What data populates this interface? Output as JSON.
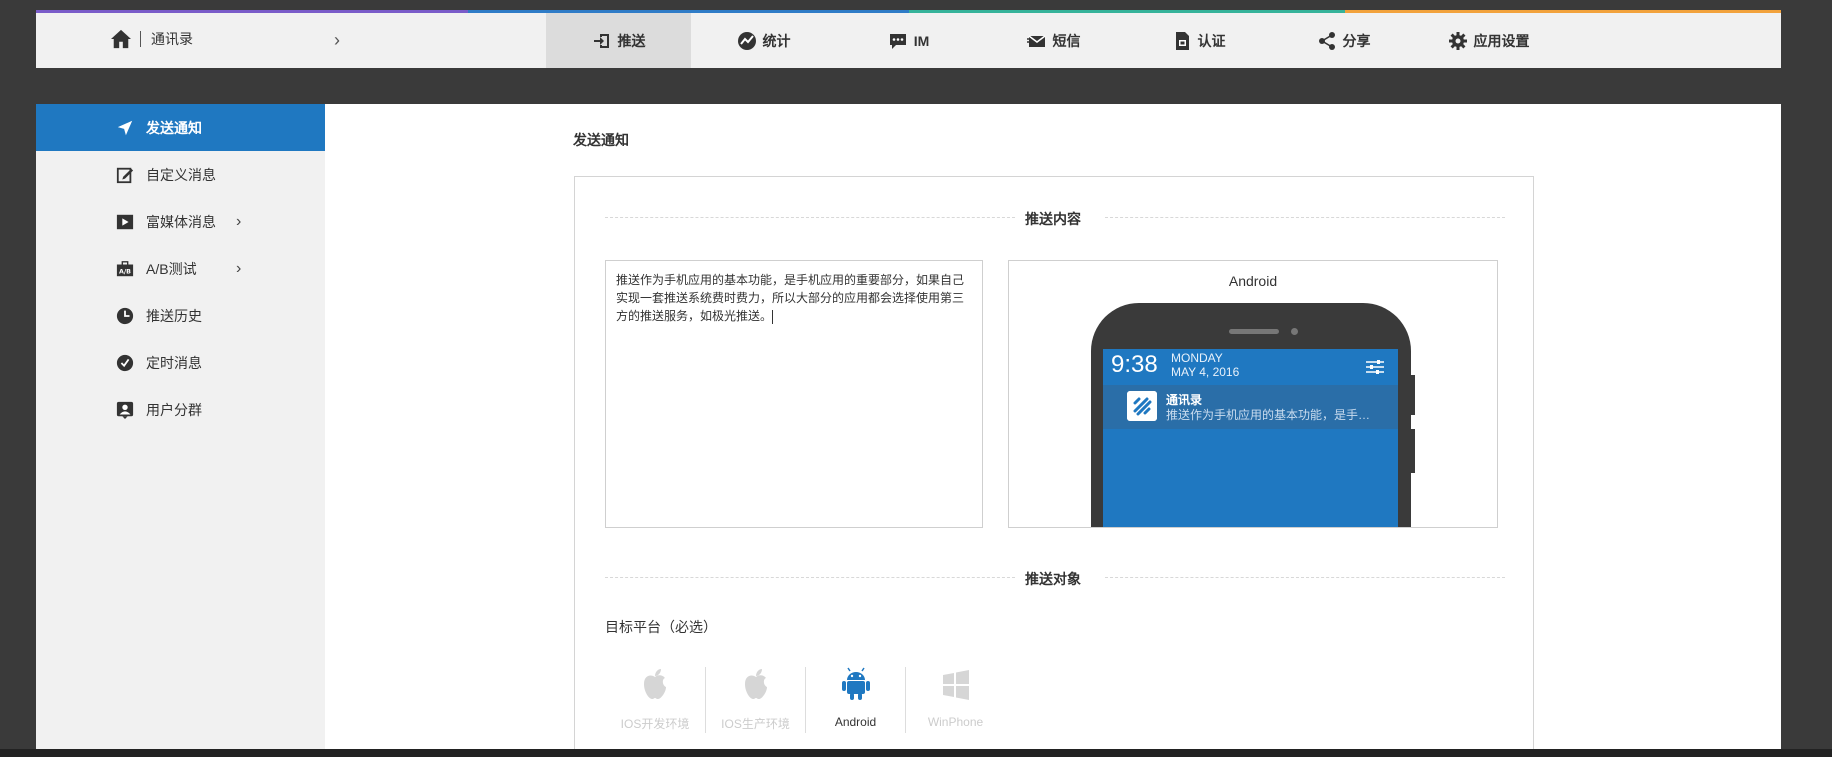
{
  "colors": {
    "accent": "#1f78c1",
    "strip": [
      "#7a5cc9",
      "#2f7cc7",
      "#36b39a",
      "#f2a23c"
    ]
  },
  "brand": {
    "icon": "home-icon",
    "label": "通讯录"
  },
  "nav": {
    "items": [
      {
        "label": "推送",
        "icon": "push-icon",
        "active": true
      },
      {
        "label": "统计",
        "icon": "stats-icon"
      },
      {
        "label": "IM",
        "icon": "chat-icon"
      },
      {
        "label": "短信",
        "icon": "sms-icon"
      },
      {
        "label": "认证",
        "icon": "auth-icon"
      },
      {
        "label": "分享",
        "icon": "share-icon"
      },
      {
        "label": "应用设置",
        "icon": "gear-icon"
      }
    ]
  },
  "sidebar": {
    "items": [
      {
        "label": "发送通知",
        "icon": "send-icon",
        "active": true
      },
      {
        "label": "自定义消息",
        "icon": "edit-icon"
      },
      {
        "label": "富媒体消息",
        "icon": "play-icon",
        "has_children": true
      },
      {
        "label": "A/B测试",
        "icon": "ab-test-icon",
        "has_children": true
      },
      {
        "label": "推送历史",
        "icon": "clock-icon"
      },
      {
        "label": "定时消息",
        "icon": "timer-icon"
      },
      {
        "label": "用户分群",
        "icon": "user-group-icon"
      }
    ]
  },
  "main": {
    "title": "发送通知",
    "section_content": "推送内容",
    "section_target": "推送对象",
    "message_text": "推送作为手机应用的基本功能，是手机应用的重要部分，如果自己实现一套推送系统费时费力，所以大部分的应用都会选择使用第三方的推送服务，如极光推送。",
    "preview": {
      "platform": "Android",
      "time": "9:38",
      "day": "MONDAY",
      "date": "MAY 4, 2016",
      "notification_title": "通讯录",
      "notification_body": "推送作为手机应用的基本功能，是手…"
    },
    "platform_label": "目标平台（必选）",
    "platforms": [
      {
        "label": "IOS开发环境",
        "icon": "apple-icon",
        "selected": false
      },
      {
        "label": "IOS生产环境",
        "icon": "apple-icon",
        "selected": false
      },
      {
        "label": "Android",
        "icon": "android-icon",
        "selected": true
      },
      {
        "label": "WinPhone",
        "icon": "windows-icon",
        "selected": false
      }
    ]
  }
}
